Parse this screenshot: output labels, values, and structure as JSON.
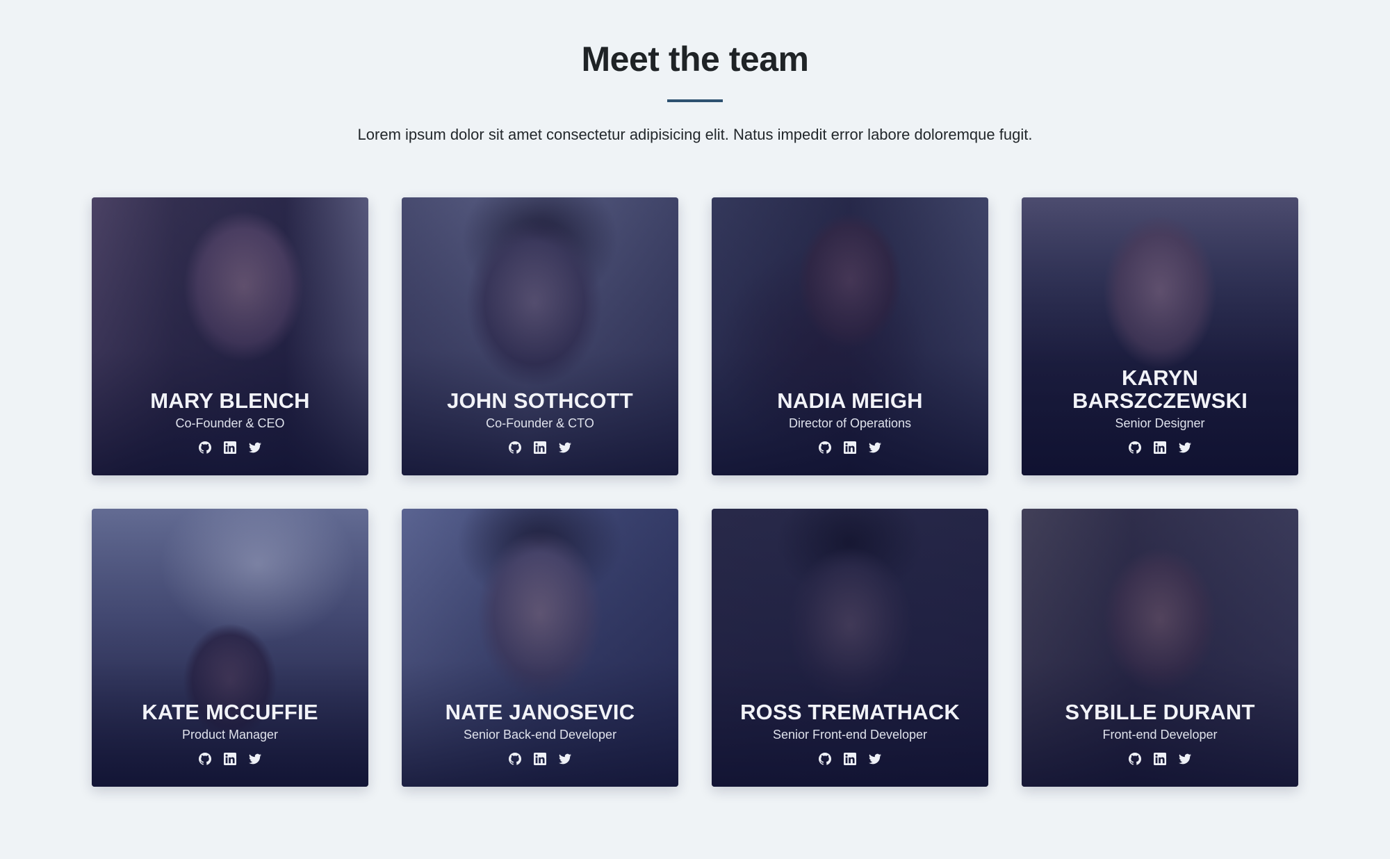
{
  "header": {
    "title": "Meet the team",
    "intro": "Lorem ipsum dolor sit amet consectetur adipisicing elit. Natus impedit error labore doloremque fugit."
  },
  "members": [
    {
      "name": "Mary Blench",
      "role": "Co-Founder & CEO"
    },
    {
      "name": "John Sothcott",
      "role": "Co-Founder & CTO"
    },
    {
      "name": "Nadia Meigh",
      "role": "Director of Operations"
    },
    {
      "name": "Karyn Barszczewski",
      "role": "Senior Designer"
    },
    {
      "name": "Kate McCuffie",
      "role": "Product Manager"
    },
    {
      "name": "Nate Janosevic",
      "role": "Senior Back-end Developer"
    },
    {
      "name": "Ross Tremathack",
      "role": "Senior Front-end Developer"
    },
    {
      "name": "Sybille Durant",
      "role": "Front-end Developer"
    }
  ],
  "social_icons": [
    "github-icon",
    "linkedin-icon",
    "twitter-icon"
  ],
  "colors": {
    "background": "#eff3f6",
    "heading": "#1f2326",
    "divider": "#2e5170",
    "card_overlay": "#141640"
  }
}
